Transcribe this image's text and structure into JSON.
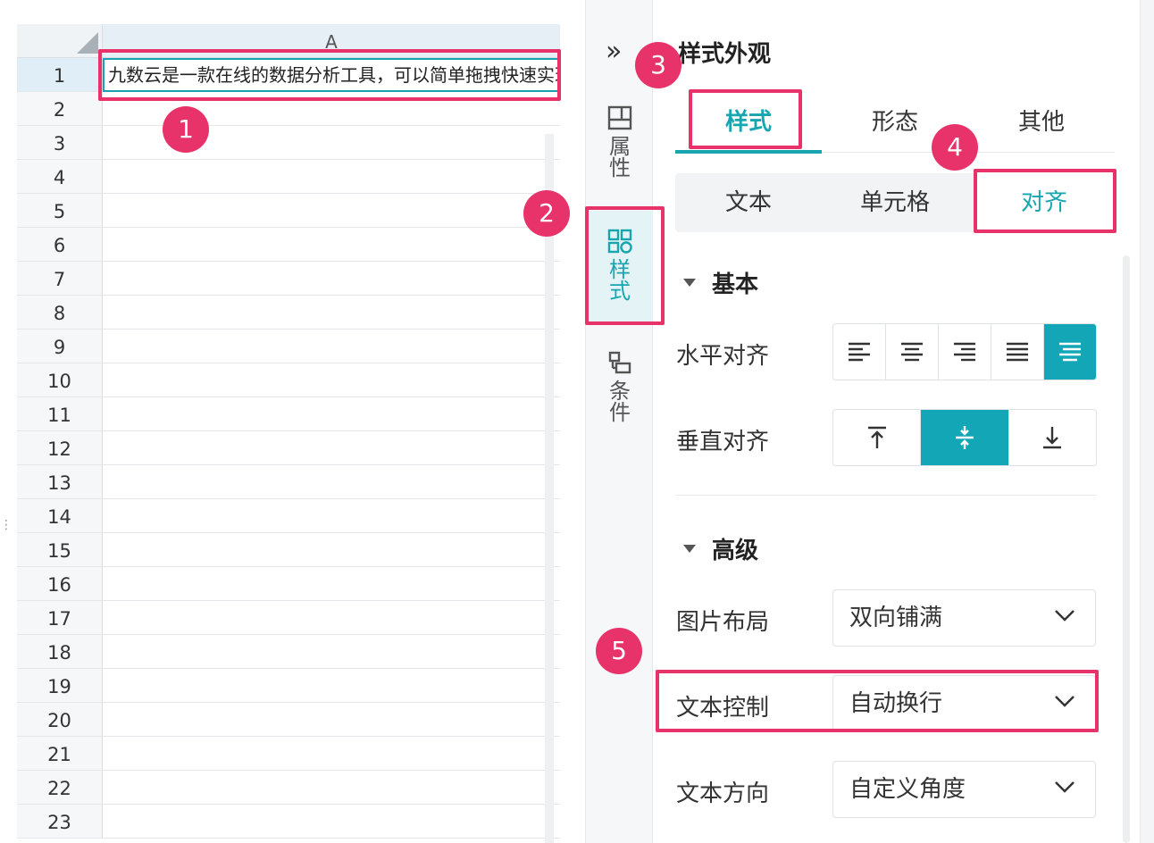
{
  "sheet": {
    "column_header": "A",
    "rows": [
      "1",
      "2",
      "3",
      "4",
      "5",
      "6",
      "7",
      "8",
      "9",
      "10",
      "11",
      "12",
      "13",
      "14",
      "15",
      "16",
      "17",
      "18",
      "19",
      "20",
      "21",
      "22",
      "23"
    ],
    "cell_a1": "九数云是一款在线的数据分析工具，可以简单拖拽快速实现数据处理和可视化图表展示，上传数据"
  },
  "rail": {
    "collapse_icon": "double-chevron-right-icon",
    "items": [
      {
        "label": "属性",
        "icon": "layout-icon"
      },
      {
        "label": "样式",
        "icon": "style-icon"
      },
      {
        "label": "条件",
        "icon": "condition-icon"
      }
    ]
  },
  "panel": {
    "title": "样式外观",
    "tabs": [
      "样式",
      "形态",
      "其他"
    ],
    "active_tab": "样式",
    "sub_tabs": [
      "文本",
      "单元格",
      "对齐"
    ],
    "active_sub_tab": "对齐",
    "sections": {
      "basic": "基本",
      "advanced": "高级"
    },
    "horizontal_align": {
      "label": "水平对齐",
      "options": [
        "align-left-icon",
        "align-center-icon",
        "align-right-icon",
        "align-justify-icon",
        "align-distributed-icon"
      ],
      "active_index": 4
    },
    "vertical_align": {
      "label": "垂直对齐",
      "options": [
        "align-top-icon",
        "align-middle-icon",
        "align-bottom-icon"
      ],
      "active_index": 1
    },
    "image_layout": {
      "label": "图片布局",
      "value": "双向铺满"
    },
    "text_control": {
      "label": "文本控制",
      "value": "自动换行"
    },
    "text_direction": {
      "label": "文本方向",
      "value": "自定义角度"
    }
  },
  "annotations": [
    "1",
    "2",
    "3",
    "4",
    "5"
  ],
  "colors": {
    "accent": "#12a6b6",
    "highlight": "#e8336a"
  }
}
